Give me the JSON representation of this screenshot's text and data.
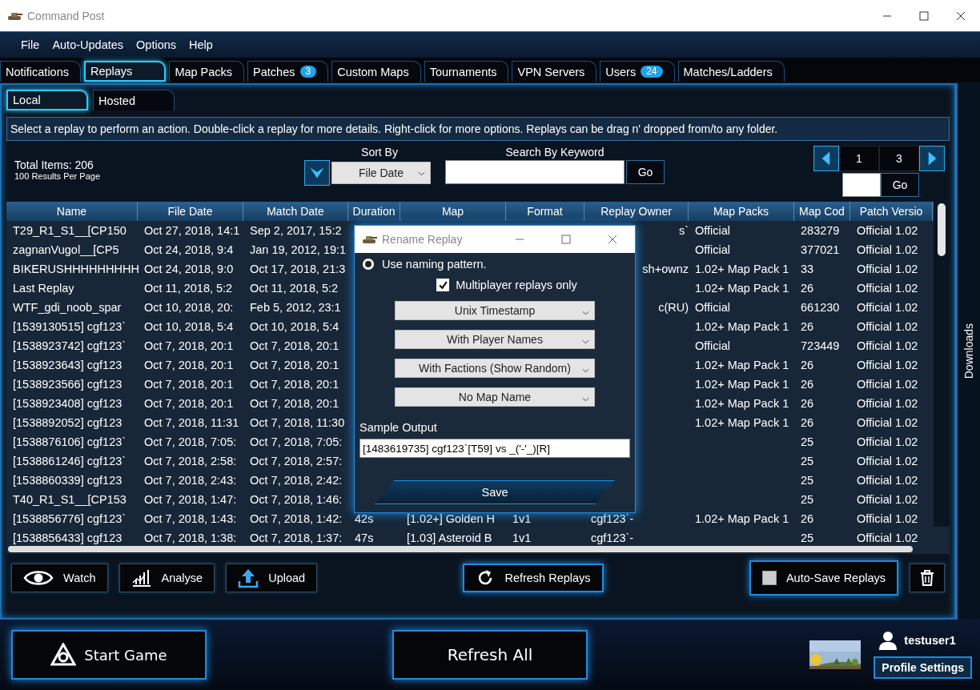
{
  "window": {
    "title": "Command Post"
  },
  "menu": [
    "File",
    "Auto-Updates",
    "Options",
    "Help"
  ],
  "tabs": [
    {
      "label": "Notifications",
      "selected": false
    },
    {
      "label": "Replays",
      "selected": true
    },
    {
      "label": "Map Packs",
      "selected": false
    },
    {
      "label": "Patches",
      "badge": "3",
      "selected": false
    },
    {
      "label": "Custom Maps",
      "selected": false
    },
    {
      "label": "Tournaments",
      "selected": false
    },
    {
      "label": "VPN Servers",
      "selected": false
    },
    {
      "label": "Users",
      "badge": "24",
      "selected": false
    },
    {
      "label": "Matches/Ladders",
      "selected": false
    }
  ],
  "subtabs": [
    {
      "label": "Local",
      "selected": true
    },
    {
      "label": "Hosted",
      "selected": false
    }
  ],
  "info": "Select a replay to perform an action. Double-click a replay for more details. Right-click for more options. Replays can be drag n' dropped from/to any folder.",
  "totals": {
    "items": "Total Items: 206",
    "per_page": "100 Results Per Page"
  },
  "sort": {
    "label": "Sort By",
    "value": "File Date"
  },
  "search": {
    "label": "Search By Keyword",
    "button": "Go"
  },
  "pagination": {
    "current": "1",
    "total": "3",
    "button": "Go"
  },
  "table": {
    "columns": [
      "Name",
      "File Date",
      "Match Date",
      "Duration",
      "Map",
      "Format",
      "Replay Owner",
      "Map Packs",
      "Map Cod",
      "Patch Versio"
    ],
    "rows": [
      {
        "cells": [
          "T29_R1_S1__[CP150",
          "Oct 27, 2018, 14:1",
          "Sep 2, 2017, 15:2",
          null,
          null,
          null,
          "s`",
          "Official",
          "283279",
          "Official 1.02"
        ]
      },
      {
        "cells": [
          "zagnanVugol__[CP5",
          "Oct 24, 2018, 9:4",
          "Jan 19, 2012, 19:1",
          null,
          null,
          null,
          null,
          "Official",
          "377021",
          "Official 1.02"
        ]
      },
      {
        "cells": [
          "BIKERUSHHHHHHHHH",
          "Oct 24, 2018, 9:0",
          "Oct 17, 2018, 21:3",
          null,
          null,
          null,
          "sh+ownz",
          "1.02+ Map Pack 1",
          "33",
          "Official 1.02"
        ]
      },
      {
        "cells": [
          "Last Replay",
          "Oct 11, 2018, 5:2",
          "Oct 11, 2018, 5:2",
          null,
          null,
          null,
          null,
          "1.02+ Map Pack 1",
          "26",
          "Official 1.02"
        ]
      },
      {
        "cells": [
          "WTF_gdi_noob_spar",
          "Oct 10, 2018, 20:",
          "Feb 5, 2012, 23:1",
          null,
          null,
          null,
          "c(RU)",
          "Official",
          "661230",
          "Official 1.02"
        ]
      },
      {
        "cells": [
          "[1539130515] cgf123`",
          "Oct 10, 2018, 5:4",
          "Oct 10, 2018, 5:4",
          null,
          null,
          null,
          null,
          "1.02+ Map Pack 1",
          "26",
          "Official 1.02"
        ]
      },
      {
        "cells": [
          "[1538923742] cgf123`",
          "Oct 7, 2018, 20:1",
          "Oct 7, 2018, 20:1",
          null,
          null,
          null,
          null,
          "Official",
          "723449",
          "Official 1.02"
        ]
      },
      {
        "cells": [
          "[1538923643] cgf123",
          "Oct 7, 2018, 20:1",
          "Oct 7, 2018, 20:1",
          null,
          null,
          null,
          null,
          "1.02+ Map Pack 1",
          "26",
          "Official 1.02"
        ]
      },
      {
        "cells": [
          "[1538923566] cgf123",
          "Oct 7, 2018, 20:1",
          "Oct 7, 2018, 20:1",
          null,
          null,
          null,
          null,
          "1.02+ Map Pack 1",
          "26",
          "Official 1.02"
        ]
      },
      {
        "cells": [
          "[1538923408] cgf123",
          "Oct 7, 2018, 20:1",
          "Oct 7, 2018, 20:1",
          null,
          null,
          null,
          null,
          "1.02+ Map Pack 1",
          "26",
          "Official 1.02"
        ]
      },
      {
        "cells": [
          "[1538892052] cgf123",
          "Oct 7, 2018, 11:31",
          "Oct 7, 2018, 11:30",
          null,
          null,
          null,
          null,
          "1.02+ Map Pack 1",
          "26",
          "Official 1.02"
        ]
      },
      {
        "cells": [
          "[1538876106] cgf123`",
          "Oct 7, 2018, 7:05:",
          "Oct 7, 2018, 7:05:",
          null,
          null,
          null,
          null,
          null,
          "25",
          "Official 1.02"
        ]
      },
      {
        "cells": [
          "[1538861246] cgf123`",
          "Oct 7, 2018, 2:58:",
          "Oct 7, 2018, 2:57:",
          null,
          null,
          null,
          null,
          null,
          "25",
          "Official 1.02"
        ]
      },
      {
        "cells": [
          "[1538860339] cgf123",
          "Oct 7, 2018, 2:43:",
          "Oct 7, 2018, 2:42:",
          null,
          null,
          null,
          null,
          null,
          "25",
          "Official 1.02"
        ]
      },
      {
        "cells": [
          "T40_R1_S1__[CP153",
          "Oct 7, 2018, 1:47:",
          "Oct 7, 2018, 1:46:",
          null,
          null,
          null,
          null,
          null,
          "25",
          "Official 1.02"
        ]
      },
      {
        "cells": [
          "[1538856776] cgf123`",
          "Oct 7, 2018, 1:43:",
          "Oct 7, 2018, 1:42:",
          "42s",
          "[1.02+] Golden H",
          "1v1",
          "cgf123`-",
          "1.02+ Map Pack 1",
          "26",
          "Official 1.02"
        ]
      },
      {
        "cells": [
          "[1538856433] cgf123",
          "Oct 7, 2018, 1:38:",
          "Oct 7, 2018, 1:37:",
          "47s",
          "[1.03] Asteroid B",
          "1v1",
          "cgf123`-",
          null,
          "25",
          "Official 1.02"
        ]
      }
    ]
  },
  "actions": [
    {
      "kind": "watch",
      "label": "Watch"
    },
    {
      "kind": "analyse",
      "label": "Analyse"
    },
    {
      "kind": "upload",
      "label": "Upload"
    },
    {
      "kind": "refresh",
      "label": "Refresh Replays"
    }
  ],
  "auto_save": {
    "label": "Auto-Save Replays",
    "checked": false
  },
  "downloads": "Downloads",
  "footer": {
    "start": "Start Game",
    "refresh": "Refresh All",
    "user": "testuser1",
    "profile": "Profile Settings"
  },
  "dialog": {
    "title": "Rename Replay",
    "radio": {
      "label": "Use naming pattern.",
      "selected": true
    },
    "checkbox": {
      "label": "Multiplayer replays only",
      "checked": true
    },
    "dropdowns": [
      "Unix Timestamp",
      "With Player Names",
      "With Factions (Show Random)",
      "No Map Name"
    ],
    "sample_label": "Sample Output",
    "sample_value": "[1483619735] cgf123`[T59] vs _('-'_)[R]",
    "save": "Save"
  }
}
